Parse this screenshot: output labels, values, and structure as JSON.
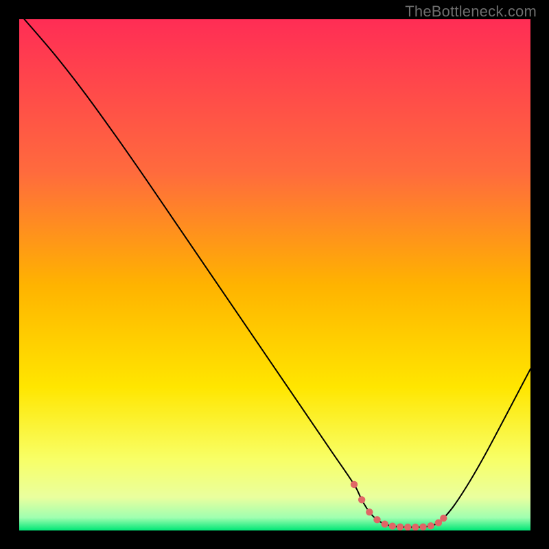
{
  "attribution": "TheBottleneck.com",
  "chart_data": {
    "type": "line",
    "title": "",
    "xlabel": "",
    "ylabel": "",
    "xlim": [
      0,
      100
    ],
    "ylim": [
      0,
      100
    ],
    "background_gradient": {
      "type": "linear-vertical",
      "stops": [
        {
          "offset": 0.0,
          "color": "#ff2d55"
        },
        {
          "offset": 0.3,
          "color": "#ff6b3d"
        },
        {
          "offset": 0.52,
          "color": "#ffb300"
        },
        {
          "offset": 0.72,
          "color": "#ffe600"
        },
        {
          "offset": 0.86,
          "color": "#f8ff66"
        },
        {
          "offset": 0.935,
          "color": "#eaff9e"
        },
        {
          "offset": 0.975,
          "color": "#9fffb0"
        },
        {
          "offset": 1.0,
          "color": "#00e676"
        }
      ]
    },
    "curve": {
      "x": [
        1,
        7,
        13,
        19,
        25,
        31,
        37,
        43,
        49,
        55,
        61,
        65.5,
        67,
        68.5,
        70,
        71.5,
        73,
        74.5,
        76,
        77.5,
        79,
        80.5,
        82,
        83,
        85,
        88,
        91,
        94,
        97,
        100
      ],
      "y": [
        100,
        93,
        85.3,
        77,
        68.4,
        59.6,
        50.8,
        42,
        33.2,
        24.4,
        15.6,
        9,
        6.0,
        3.6,
        2.1,
        1.25,
        0.85,
        0.7,
        0.65,
        0.65,
        0.7,
        0.9,
        1.5,
        2.4,
        4.8,
        9.4,
        14.6,
        20.2,
        25.9,
        31.6
      ]
    },
    "markers": {
      "x": [
        65.5,
        67,
        68.5,
        70,
        71.5,
        73,
        74.5,
        76,
        77.5,
        79,
        80.5,
        82,
        83
      ],
      "y": [
        9.0,
        6.0,
        3.6,
        2.1,
        1.25,
        0.85,
        0.7,
        0.65,
        0.65,
        0.7,
        0.9,
        1.5,
        2.4
      ],
      "color": "#e06666",
      "radius": 5.2
    },
    "line_style": {
      "color": "#000000",
      "width": 2.0
    }
  }
}
